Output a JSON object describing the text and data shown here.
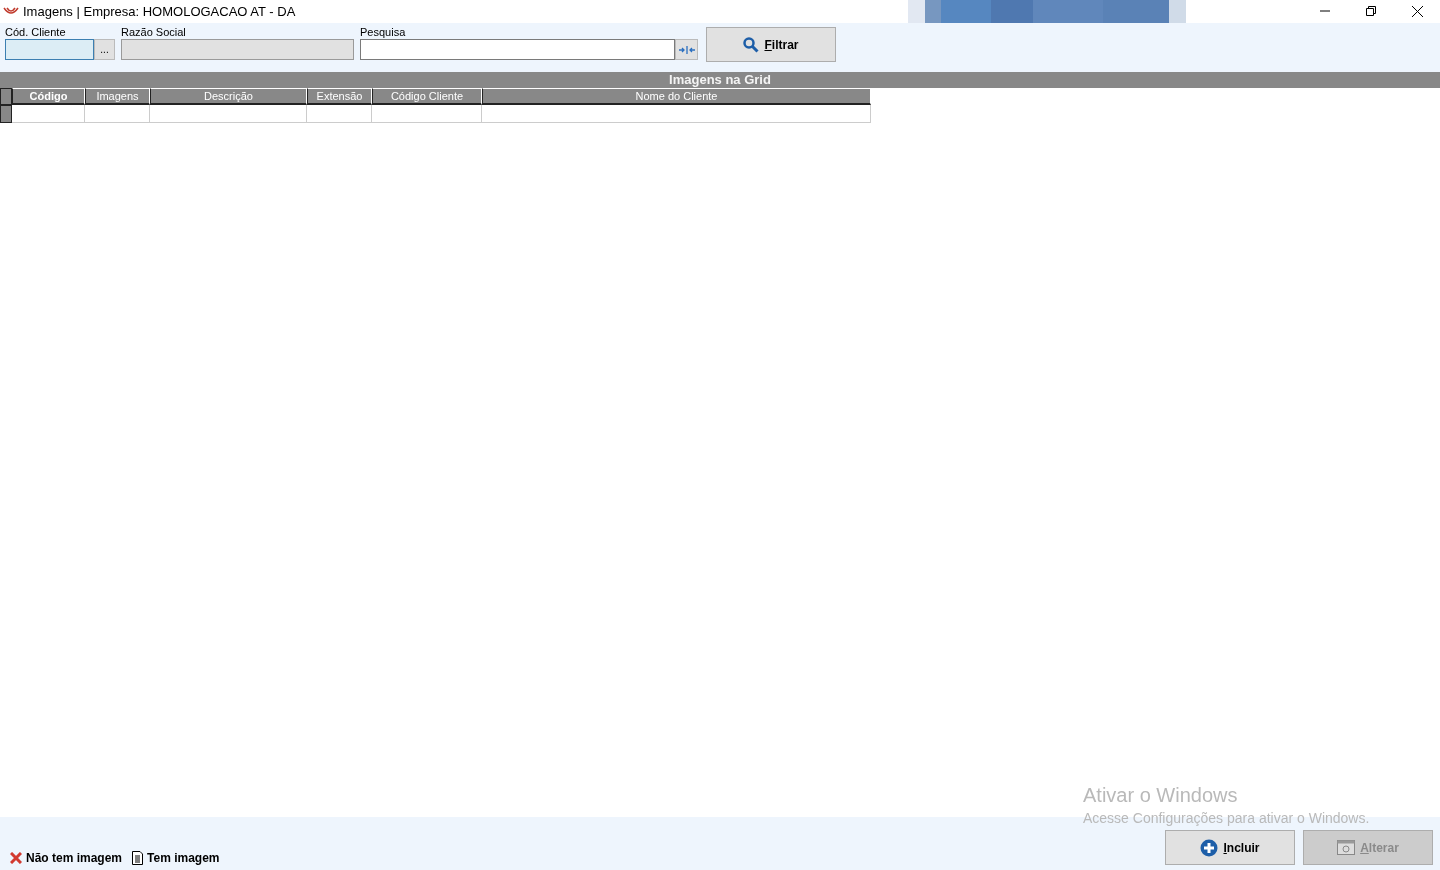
{
  "window": {
    "title": "Imagens | Empresa: HOMOLOGACAO AT - DA"
  },
  "filters": {
    "client_code": {
      "label": "Cód. Cliente",
      "focused": true,
      "lookup": "..."
    },
    "company_name": {
      "label": "Razão Social",
      "disabled": true
    },
    "search": {
      "label": "Pesquisa"
    },
    "filter_button": {
      "label": "Filtrar"
    }
  },
  "grid": {
    "title": "Imagens na Grid",
    "columns": [
      {
        "label": "Código",
        "bold": true
      },
      {
        "label": "Imagens",
        "bold": false
      },
      {
        "label": "Descrição",
        "bold": false
      },
      {
        "label": "Extensão",
        "bold": false
      },
      {
        "label": "Código Cliente",
        "bold": false
      },
      {
        "label": "Nome do Cliente",
        "bold": false
      }
    ]
  },
  "legend": [
    {
      "kind": "no-image",
      "label": "Não tem imagem"
    },
    {
      "kind": "has-image",
      "label": "Tem imagem"
    }
  ],
  "buttons": [
    {
      "kind": "add",
      "label": "Incluir",
      "disabled": false
    },
    {
      "kind": "edit",
      "label": "Alterar",
      "disabled": true
    }
  ],
  "os_notice": {
    "title": "Ativar o Windows",
    "text": "Acesse Configurações para ativar o Windows."
  }
}
